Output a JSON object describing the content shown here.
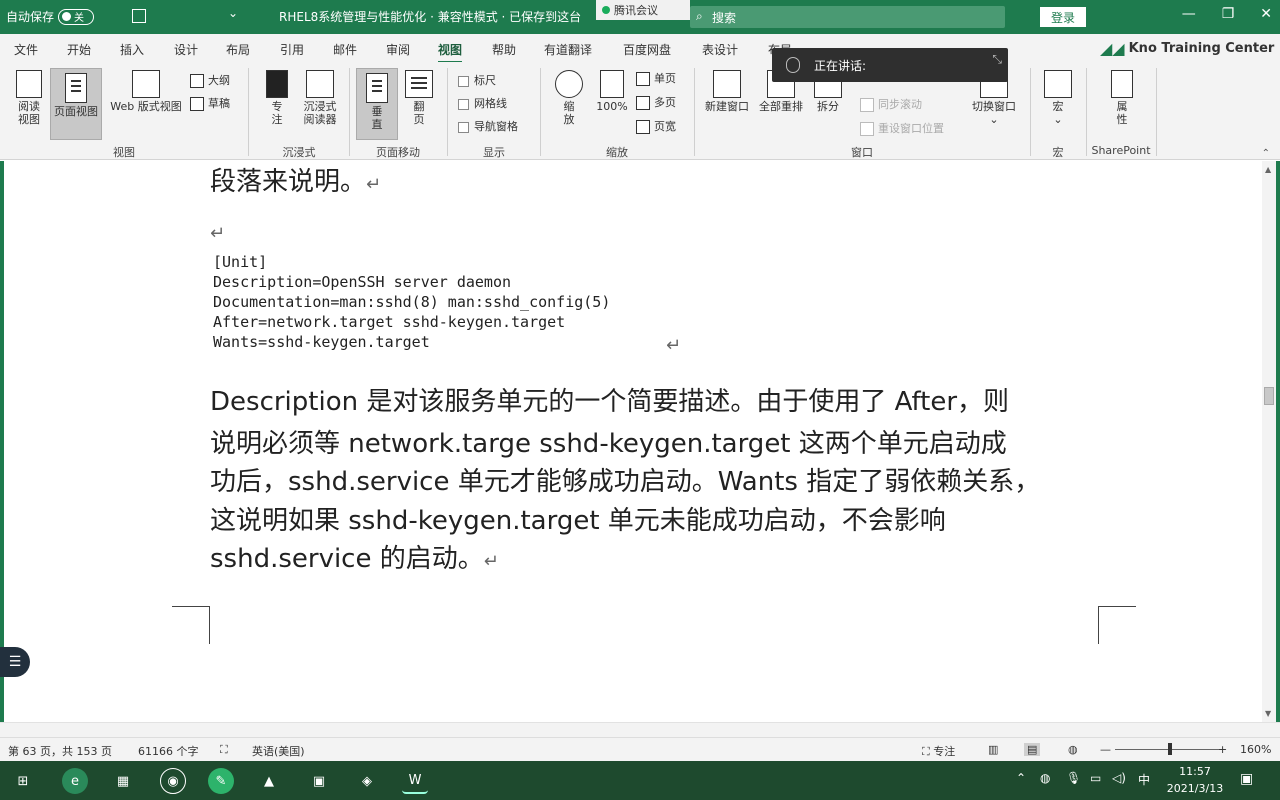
{
  "titlebar": {
    "autosave_label": "自动保存",
    "autosave_state": "关",
    "more_label": "⌄",
    "doc_title": "RHEL8系统管理与性能优化 · 兼容性模式 · 已保存到这台",
    "meeting_label": "腾讯会议",
    "search_placeholder": "搜索",
    "login_label": "登录",
    "win_min": "—",
    "win_max": "❐",
    "win_close": "✕"
  },
  "tabs": [
    {
      "label": "文件"
    },
    {
      "label": "开始"
    },
    {
      "label": "插入"
    },
    {
      "label": "设计"
    },
    {
      "label": "布局"
    },
    {
      "label": "引用"
    },
    {
      "label": "邮件"
    },
    {
      "label": "审阅"
    },
    {
      "label": "视图",
      "active": true
    },
    {
      "label": "帮助"
    },
    {
      "label": "有道翻译"
    },
    {
      "label": "百度网盘"
    },
    {
      "label": "表设计"
    },
    {
      "label": "布局"
    }
  ],
  "brand": "Kno Training Center",
  "ribbon": {
    "view_group": {
      "label": "视图",
      "read_mode": "阅读视图",
      "print_layout": "页面视图",
      "web_layout": "Web 版式视图",
      "outline": "大纲",
      "draft": "草稿"
    },
    "immersive_group": {
      "label": "沉浸式",
      "focus": "专注",
      "immersive_reader": "沉浸式阅读器"
    },
    "page_move_group": {
      "label": "页面移动",
      "vertical": "垂直",
      "side_to_side": "翻页"
    },
    "show_group": {
      "label": "显示",
      "ruler": "标尺",
      "gridlines": "网格线",
      "nav_pane": "导航窗格"
    },
    "zoom_group": {
      "label": "缩放",
      "zoom": "缩放",
      "hundred": "100%",
      "one_page": "单页",
      "multi_page": "多页",
      "page_width": "页宽"
    },
    "window_group": {
      "label": "窗口",
      "new_window": "新建窗口",
      "arrange_all": "全部重排",
      "split": "拆分",
      "sync_scroll": "同步滚动",
      "reset_position": "重设窗口位置",
      "switch_window": "切换窗口"
    },
    "macro_group": {
      "label": "宏",
      "macros": "宏"
    },
    "sharepoint_group": {
      "label": "SharePoint",
      "properties": "属性"
    }
  },
  "popup": {
    "text": "正在讲话:"
  },
  "document": {
    "line0": "段落来说明。",
    "code": [
      "[Unit]",
      "Description=OpenSSH server daemon",
      "Documentation=man:sshd(8) man:sshd_config(5)",
      "After=network.target sshd-keygen.target",
      "Wants=sshd-keygen.target"
    ],
    "para": [
      "Description 是对该服务单元的一个简要描述。由于使用了 After，则",
      "说明必须等 network.targe   sshd-keygen.target 这两个单元启动成",
      "功后，sshd.service 单元才能够成功启动。Wants 指定了弱依赖关系，",
      "这说明如果 sshd-keygen.target 单元未能成功启动，不会影响",
      "sshd.service 的启动。"
    ],
    "para_mark": "↵"
  },
  "statusbar": {
    "page": "第 63 页，共 153 页",
    "words": "61166 个字",
    "language": "英语(美国)",
    "focus": "专注",
    "zoom_minus": "—",
    "zoom_plus": "+",
    "zoom": "160%"
  },
  "taskbar": {
    "time": "11:57",
    "date": "2021/3/13",
    "ime": "中",
    "notifications": "▣"
  },
  "colors": {
    "accent": "#1e7b4e",
    "taskbar": "#1e4a2e"
  }
}
